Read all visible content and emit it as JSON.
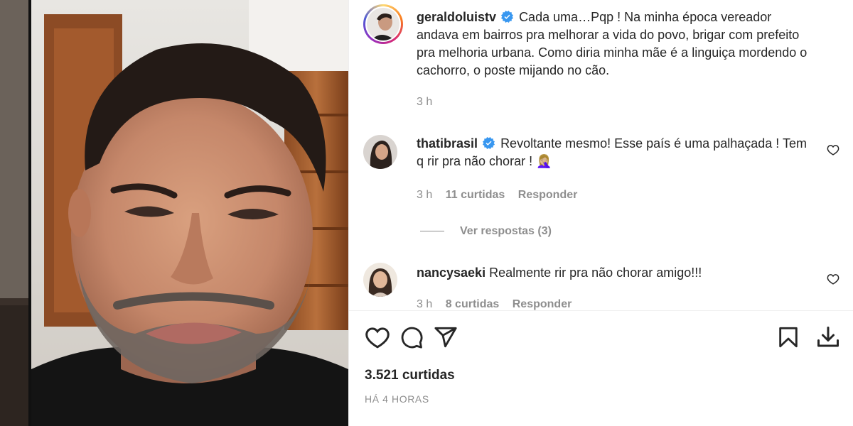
{
  "post": {
    "author": "geraldoluistv",
    "caption": "Cada uma…Pqp ! Na minha época vereador andava em bairros pra melhorar a vida do povo, brigar com prefeito pra melhoria urbana. Como diria minha mãe é a linguiça mordendo o cachorro, o poste mijando no cão.",
    "time": "3 h",
    "likes": "3.521 curtidas",
    "posted_ago": "HÁ 4 HORAS"
  },
  "comments": [
    {
      "user": "thatibrasil",
      "verified": true,
      "text": "Revoltante mesmo! Esse país é uma palhaçada ! Tem q rir pra não chorar ! 🤦🏼‍♀️",
      "time": "3 h",
      "likes": "11 curtidas",
      "reply": "Responder",
      "view_replies": "Ver respostas (3)"
    },
    {
      "user": "nancysaeki",
      "verified": false,
      "text": "Realmente rir pra não chorar amigo!!!",
      "time": "3 h",
      "likes": "8 curtidas",
      "reply": "Responder"
    }
  ],
  "icons": {
    "like": "heart-icon",
    "comment": "comment-icon",
    "share": "share-icon",
    "save": "bookmark-icon",
    "download": "download-icon",
    "verified": "verified-badge-icon"
  },
  "colors": {
    "text": "#262626",
    "muted": "#8e8e8e",
    "verified": "#3897f0"
  }
}
